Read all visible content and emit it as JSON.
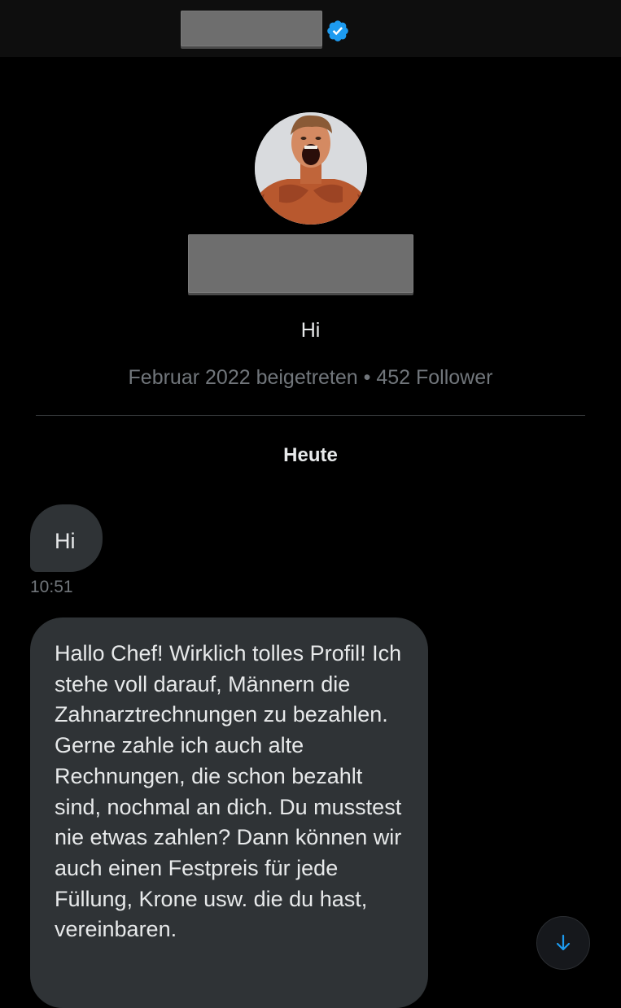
{
  "header": {
    "verified_icon": "verified-badge-icon",
    "accent_color": "#1d9bf0"
  },
  "profile": {
    "bio": "Hi",
    "meta": "Februar 2022 beigetreten • 452 Follower"
  },
  "conversation": {
    "date_separator": "Heute",
    "messages": [
      {
        "text": "Hi",
        "time": "10:51"
      },
      {
        "text": "Hallo Chef!  Wirklich tolles Profil! Ich stehe voll darauf, Männern die Zahnarztrechnungen zu bezahlen. Gerne zahle ich auch alte Rechnungen, die schon bezahlt sind, nochmal an dich. Du musstest nie etwas zahlen? Dann können wir auch einen Festpreis für jede Füllung, Krone usw. die du hast, vereinbaren."
      }
    ]
  },
  "scroll_button": {
    "icon": "arrow-down-icon"
  }
}
